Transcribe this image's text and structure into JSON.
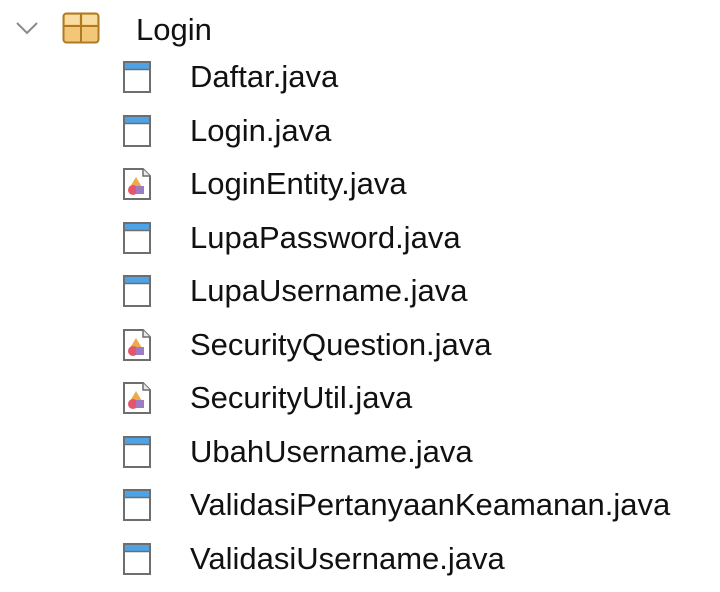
{
  "tree": {
    "package": {
      "label": "Login",
      "icon": "package-icon",
      "expanded": true,
      "chevron": "chevron-down-icon"
    },
    "files": [
      {
        "label": "Daftar.java",
        "icon": "form-file-icon"
      },
      {
        "label": "Login.java",
        "icon": "form-file-icon"
      },
      {
        "label": "LoginEntity.java",
        "icon": "class-file-icon"
      },
      {
        "label": "LupaPassword.java",
        "icon": "form-file-icon"
      },
      {
        "label": "LupaUsername.java",
        "icon": "form-file-icon"
      },
      {
        "label": "SecurityQuestion.java",
        "icon": "class-file-icon"
      },
      {
        "label": "SecurityUtil.java",
        "icon": "class-file-icon"
      },
      {
        "label": "UbahUsername.java",
        "icon": "form-file-icon"
      },
      {
        "label": "ValidasiPertanyaanKeamanan.java",
        "icon": "form-file-icon"
      },
      {
        "label": "ValidasiUsername.java",
        "icon": "form-file-icon"
      }
    ]
  },
  "colors": {
    "text": "#111111",
    "chevron": "#8a8a8a",
    "package_fill": "#f2c777",
    "package_stroke": "#b07a22",
    "form_bar": "#4da3e8",
    "file_stroke": "#6e6e6e",
    "class_red": "#e5556b",
    "class_orange": "#f0a848"
  }
}
